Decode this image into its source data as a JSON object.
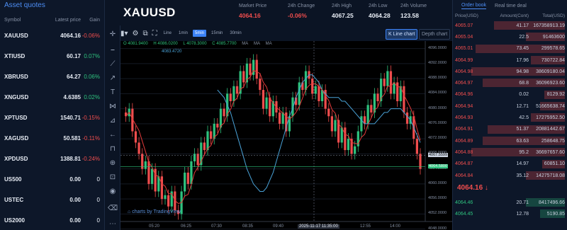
{
  "left_panel": {
    "title": "Asset quotes",
    "headers": {
      "symbol": "Symbol",
      "price": "Latest price",
      "gain": "Gain"
    },
    "rows": [
      {
        "symbol": "XAUUSD",
        "price": "4064.16",
        "gain": "-0.06%",
        "dir": "down"
      },
      {
        "symbol": "XTIUSD",
        "price": "60.17",
        "gain": "0.07%",
        "dir": "up"
      },
      {
        "symbol": "XBRUSD",
        "price": "64.27",
        "gain": "0.06%",
        "dir": "up"
      },
      {
        "symbol": "XNGUSD",
        "price": "4.6385",
        "gain": "0.02%",
        "dir": "up"
      },
      {
        "symbol": "XPTUSD",
        "price": "1540.71",
        "gain": "-0.15%",
        "dir": "down"
      },
      {
        "symbol": "XAGUSD",
        "price": "50.581",
        "gain": "-0.11%",
        "dir": "down"
      },
      {
        "symbol": "XPDUSD",
        "price": "1388.81",
        "gain": "-0.24%",
        "dir": "down"
      },
      {
        "symbol": "US500",
        "price": "0.00",
        "gain": "0",
        "dir": "neutral"
      },
      {
        "symbol": "USTEC",
        "price": "0.00",
        "gain": "0",
        "dir": "neutral"
      },
      {
        "symbol": "US2000",
        "price": "0.00",
        "gain": "0",
        "dir": "neutral"
      }
    ]
  },
  "header": {
    "symbol": "XAUUSD",
    "stats": [
      {
        "label": "Market Price",
        "value": "4064.16",
        "color": "#ef4d4d"
      },
      {
        "label": "24h Change",
        "value": "-0.06%",
        "color": "#ef4d4d"
      },
      {
        "label": "24h High",
        "value": "4067.25",
        "color": "#e8edf5"
      },
      {
        "label": "24h Low",
        "value": "4064.28",
        "color": "#e8edf5"
      },
      {
        "label": "24h Volume",
        "value": "123.58",
        "color": "#e8edf5"
      }
    ]
  },
  "toolbar": {
    "intervals": [
      "Line",
      "1min",
      "5min",
      "15min",
      "30min"
    ],
    "selected_interval": "5min",
    "kline_label": "K Line chart",
    "depth_label": "Depth chart"
  },
  "chart_data": {
    "type": "candlestick",
    "symbol": "XAUUSD",
    "interval": "5min",
    "ohlc_readout": {
      "open": "O 4081.9400",
      "high": "H 4086.0200",
      "low": "L 4078.3000",
      "close": "C 4085.7700"
    },
    "ma_labels": [
      "MA",
      "MA",
      "MA"
    ],
    "ma_value": "4083.4720",
    "ylim": [
      4050,
      4098
    ],
    "y_ticks": [
      "4096.0000",
      "4092.0000",
      "4088.0000",
      "4084.0000",
      "4080.0000",
      "4076.0000",
      "4072.0000",
      "4068.0000",
      "4064.0000",
      "4060.0000",
      "4056.0000",
      "4052.0000",
      "4048.0000"
    ],
    "x_ticks": [
      "05:20",
      "06:25",
      "07:30",
      "08:35",
      "09:40",
      "12:55",
      "14:00"
    ],
    "crosshair_time": "2025-11-17 11:35:00",
    "crosshair_price": "4067.5599",
    "last_price_label": "4064.5800",
    "closes": [
      4078,
      4080,
      4074,
      4071,
      4068,
      4064,
      4066,
      4060,
      4064,
      4058,
      4062,
      4056,
      4057,
      4054,
      4058,
      4053,
      4052,
      4058,
      4063,
      4060,
      4066,
      4068,
      4065,
      4071,
      4069,
      4074,
      4072,
      4076,
      4075,
      4080,
      4078,
      4084,
      4082,
      4086,
      4084,
      4090,
      4087,
      4092,
      4089,
      4093,
      4088,
      4085,
      4080,
      4083,
      4078,
      4082,
      4079,
      4076,
      4079,
      4074,
      4078,
      4083,
      4081,
      4087,
      4085,
      4090,
      4088,
      4084,
      4086,
      4082,
      4085,
      4080,
      4078,
      4074,
      4077,
      4071,
      4075,
      4069,
      4072,
      4068,
      4070,
      4074,
      4078,
      4076,
      4081,
      4079,
      4084,
      4082,
      4088,
      4086,
      4090,
      4084,
      4087,
      4082,
      4086,
      4079,
      4076,
      4078,
      4072,
      4068,
      4064
    ],
    "ma_values": [
      4085,
      4084,
      4083,
      4081,
      4079,
      4076,
      4073,
      4070,
      4067,
      4064,
      4062,
      4060,
      4059,
      4058,
      4058,
      4059,
      4061,
      4063,
      4066,
      4069,
      4072,
      4075,
      4078,
      4080,
      4083,
      4085,
      4087,
      4088,
      4089,
      4089,
      4088,
      4087,
      4085,
      4084,
      4083,
      4083,
      4083,
      4083,
      4082,
      4082,
      4081,
      4080,
      4079,
      4078,
      4077,
      4076,
      4076,
      4076,
      4076,
      4077,
      4078,
      4079,
      4079,
      4080,
      4080,
      4080,
      4080,
      4079,
      4078,
      4077,
      4075,
      4073,
      4071
    ]
  },
  "chart_footer": {
    "watermark": "charts by TradingView"
  },
  "order_book": {
    "tabs": [
      "Order book",
      "Real time deal"
    ],
    "headers": {
      "price": "Price(USD)",
      "amount": "Amount(Cont)",
      "total": "Total(USD)"
    },
    "asks": [
      {
        "price": "4065.07",
        "amount": "41.17",
        "total": "167358913.19",
        "depth": 0.62
      },
      {
        "price": "4065.04",
        "amount": "22.5",
        "total": "91463600",
        "depth": 0.34
      },
      {
        "price": "4065.01",
        "amount": "73.45",
        "total": "299578.65",
        "depth": 0.78
      },
      {
        "price": "4064.99",
        "amount": "17.96",
        "total": "730722.84",
        "depth": 0.3
      },
      {
        "price": "4064.98",
        "amount": "94.98",
        "total": "38609180.04",
        "depth": 0.82
      },
      {
        "price": "4064.97",
        "amount": "68.8",
        "total": "36096923.60",
        "depth": 0.72
      },
      {
        "price": "4064.96",
        "amount": "0.02",
        "total": "8129.92",
        "depth": 0.18
      },
      {
        "price": "4064.94",
        "amount": "12.71",
        "total": "51665638.74",
        "depth": 0.22
      },
      {
        "price": "4064.93",
        "amount": "42.5",
        "total": "17275952.50",
        "depth": 0.3
      },
      {
        "price": "4064.91",
        "amount": "51.37",
        "total": "20881442.67",
        "depth": 0.68
      },
      {
        "price": "4064.89",
        "amount": "63.63",
        "total": "258648.75",
        "depth": 0.72
      },
      {
        "price": "4064.88",
        "amount": "95.2",
        "total": "36697657.60",
        "depth": 0.82
      },
      {
        "price": "4064.87",
        "amount": "14.97",
        "total": "60851.10",
        "depth": 0.2
      },
      {
        "price": "4064.84",
        "amount": "35.12",
        "total": "14275718.08",
        "depth": 0.34
      }
    ],
    "mid_price": "4064.16 ↓",
    "bids": [
      {
        "price": "4064.46",
        "amount": "20.71",
        "total": "8417496.66",
        "depth": 0.34
      },
      {
        "price": "4064.45",
        "amount": "12.78",
        "total": "5190.85",
        "depth": 0.22
      }
    ]
  }
}
